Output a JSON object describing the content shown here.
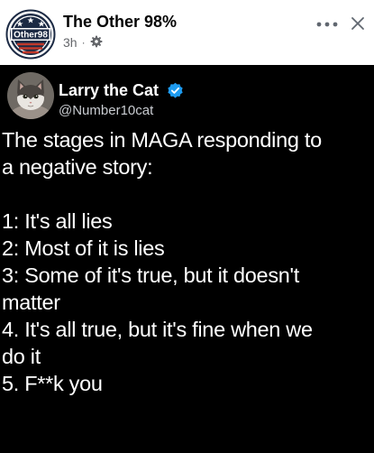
{
  "post": {
    "page_name": "The Other 98%",
    "logo_text": "Other98",
    "time": "3h",
    "separator": "·",
    "more_icon": "more-horizontal-icon",
    "close_icon": "close-icon",
    "privacy_icon": "gear-icon"
  },
  "tweet": {
    "author_name": "Larry the Cat",
    "handle": "@Number10cat",
    "verified_color": "#1d9bf0",
    "body_lines": [
      "The stages in MAGA responding to",
      "a negative story:",
      "",
      "1: It's all lies",
      "2: Most of it is lies",
      "3: Some of it's true, but it doesn't",
      "matter",
      "4. It's all true, but it's fine when we",
      "do it",
      "5. F**k you"
    ]
  },
  "colors": {
    "header_bg": "#ffffff",
    "tweet_bg": "#000000",
    "text_primary": "#050505",
    "text_secondary": "#65676b"
  }
}
